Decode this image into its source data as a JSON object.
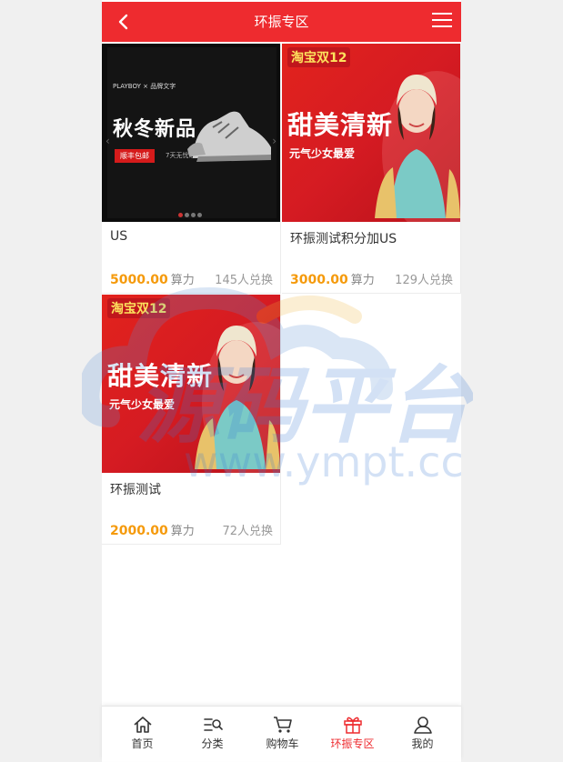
{
  "header": {
    "title": "环振专区"
  },
  "products": [
    {
      "name": "US",
      "price": "5000.00",
      "unit": "算力",
      "exchanged": "145人兑换",
      "image": {
        "brand": "PLAYBOY × 品牌文字",
        "title": "秋冬新品",
        "tag": "顺丰包邮",
        "tag2": "7天无忧退换"
      }
    },
    {
      "name": "环振测试积分加US",
      "price": "3000.00",
      "unit": "算力",
      "exchanged": "129人兑换",
      "image": {
        "badge": "淘宝双12",
        "title": "甜美清新",
        "sub": "元气少女最爱"
      }
    },
    {
      "name": "环振测试",
      "price": "2000.00",
      "unit": "算力",
      "exchanged": "72人兑换",
      "image": {
        "badge": "淘宝双12",
        "title": "甜美清新",
        "sub": "元气少女最爱"
      }
    }
  ],
  "tabbar": [
    {
      "label": "首页",
      "icon": "home-icon"
    },
    {
      "label": "分类",
      "icon": "category-icon"
    },
    {
      "label": "购物车",
      "icon": "cart-icon"
    },
    {
      "label": "环振专区",
      "icon": "gift-icon",
      "active": true
    },
    {
      "label": "我的",
      "icon": "user-icon"
    }
  ],
  "watermark": {
    "text1": "源码平台",
    "text2": "www.ympt.cc"
  },
  "colors": {
    "accent": "#ee2b2f",
    "price": "#f59a0b"
  }
}
